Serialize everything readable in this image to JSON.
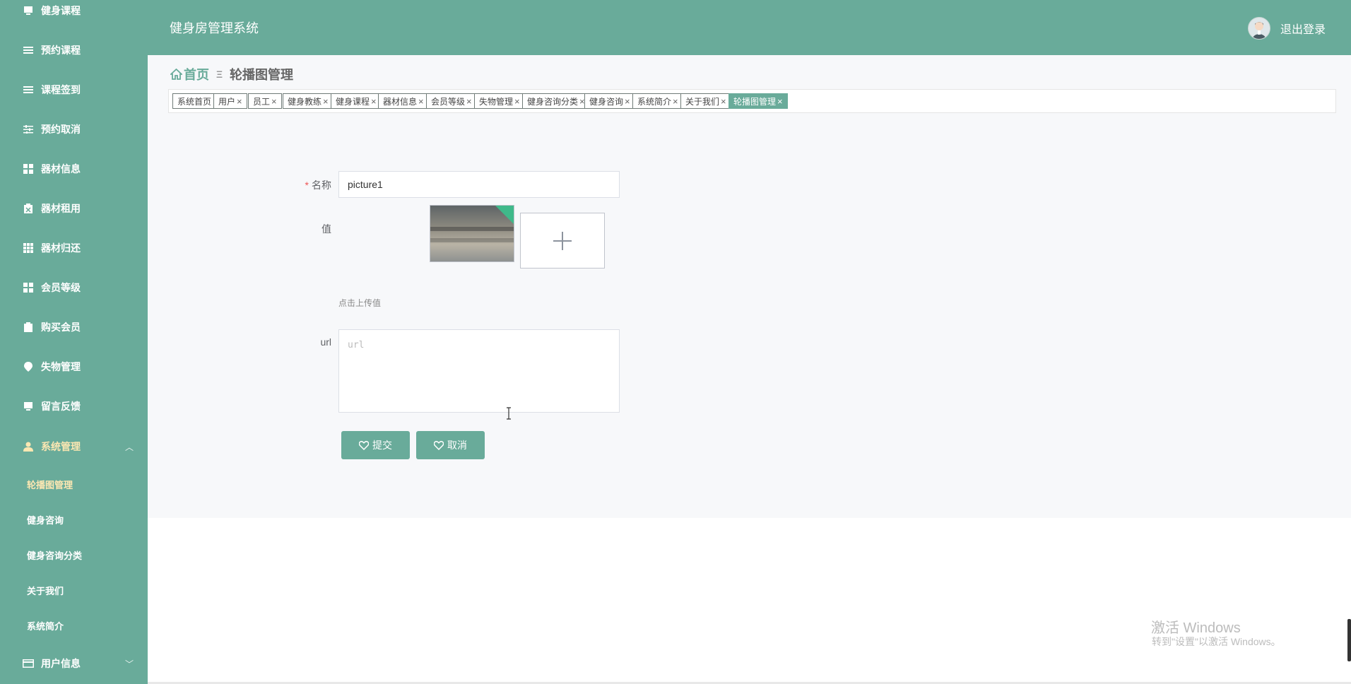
{
  "sidebar": {
    "items": [
      {
        "label": "健身课程",
        "icon": "monitor-icon"
      },
      {
        "label": "预约课程",
        "icon": "list-icon"
      },
      {
        "label": "课程签到",
        "icon": "list-icon"
      },
      {
        "label": "预约取消",
        "icon": "sliders-icon"
      },
      {
        "label": "器材信息",
        "icon": "grid-icon"
      },
      {
        "label": "器材租用",
        "icon": "clipboard-icon"
      },
      {
        "label": "器材归还",
        "icon": "table-icon"
      },
      {
        "label": "会员等级",
        "icon": "grid-icon"
      },
      {
        "label": "购买会员",
        "icon": "clipboard-icon"
      },
      {
        "label": "失物管理",
        "icon": "pin-icon"
      },
      {
        "label": "留言反馈",
        "icon": "monitor-icon"
      }
    ],
    "system": {
      "label": "系统管理",
      "icon": "user-icon",
      "chevron": "chevron-up-icon"
    },
    "sub_items": [
      {
        "label": "轮播图管理",
        "active": true
      },
      {
        "label": "健身咨询"
      },
      {
        "label": "健身咨询分类"
      },
      {
        "label": "关于我们"
      },
      {
        "label": "系统简介"
      }
    ],
    "user_info": {
      "label": "用户信息",
      "icon": "card-icon",
      "chevron": "chevron-down-icon"
    }
  },
  "header": {
    "title": "健身房管理系统",
    "logout": "退出登录"
  },
  "breadcrumb": {
    "home": "首页",
    "separator": "Ξ",
    "current": "轮播图管理"
  },
  "tabs": [
    {
      "label": "系统首页",
      "closable": false
    },
    {
      "label": "用户",
      "closable": true
    },
    {
      "label": "员工",
      "closable": true
    },
    {
      "label": "健身教练",
      "closable": true
    },
    {
      "label": "健身课程",
      "closable": true
    },
    {
      "label": "器材信息",
      "closable": true
    },
    {
      "label": "会员等级",
      "closable": true
    },
    {
      "label": "失物管理",
      "closable": true
    },
    {
      "label": "健身咨询分类",
      "closable": true
    },
    {
      "label": "健身咨询",
      "closable": true
    },
    {
      "label": "系统简介",
      "closable": true
    },
    {
      "label": "关于我们",
      "closable": true
    },
    {
      "label": "轮播图管理",
      "closable": true,
      "active": true
    }
  ],
  "form": {
    "name_label": "名称",
    "name_required": "*",
    "name_value": "picture1",
    "value_label": "值",
    "upload_hint": "点击上传值",
    "url_label": "url",
    "url_placeholder": "url",
    "submit": "提交",
    "cancel": "取消"
  },
  "watermark": {
    "line1": "激活 Windows",
    "line2": "转到\"设置\"以激活 Windows。"
  },
  "colors": {
    "accent": "#69ab9a",
    "active_sub": "#fce7b2"
  }
}
